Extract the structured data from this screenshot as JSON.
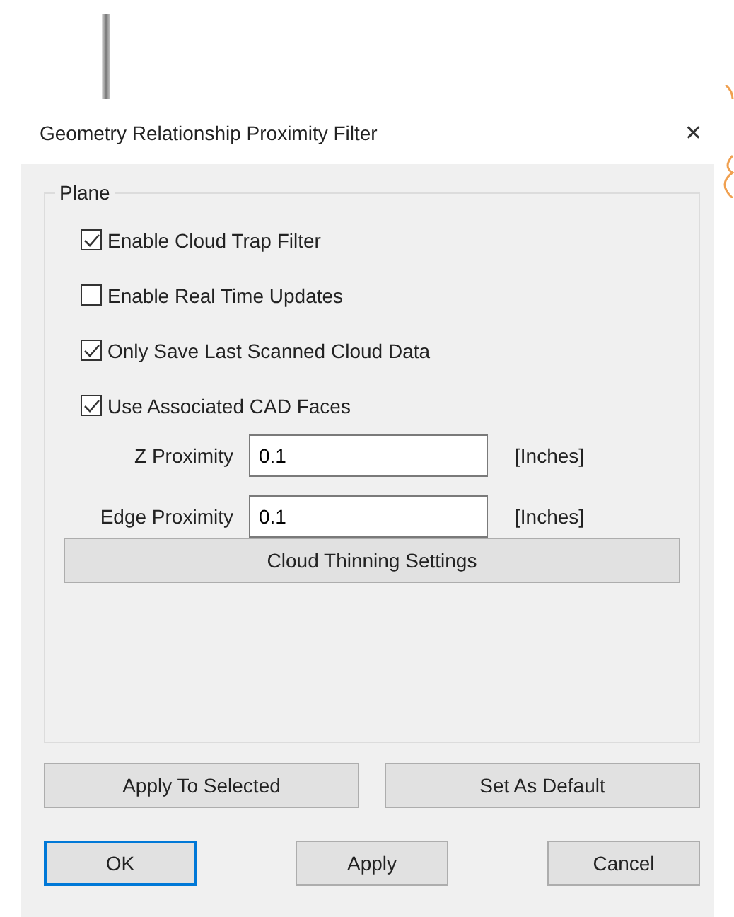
{
  "window": {
    "title": "Geometry Relationship Proximity Filter",
    "close": "✕"
  },
  "group": {
    "title": "Plane",
    "options": [
      {
        "label": "Enable Cloud Trap Filter",
        "checked": true
      },
      {
        "label": "Enable Real Time Updates",
        "checked": false
      },
      {
        "label": "Only Save Last Scanned Cloud Data",
        "checked": true
      },
      {
        "label": "Use Associated CAD Faces",
        "checked": true
      }
    ],
    "fields": [
      {
        "label": "Z Proximity",
        "value": "0.1",
        "unit": "[Inches]"
      },
      {
        "label": "Edge Proximity",
        "value": "0.1",
        "unit": "[Inches]"
      }
    ],
    "button": "Cloud Thinning Settings"
  },
  "actions": [
    "Apply To Selected",
    "Set As Default"
  ],
  "buttons": [
    {
      "label": "OK",
      "selected": true
    },
    {
      "label": "Apply",
      "selected": false
    },
    {
      "label": "Cancel",
      "selected": false
    }
  ]
}
